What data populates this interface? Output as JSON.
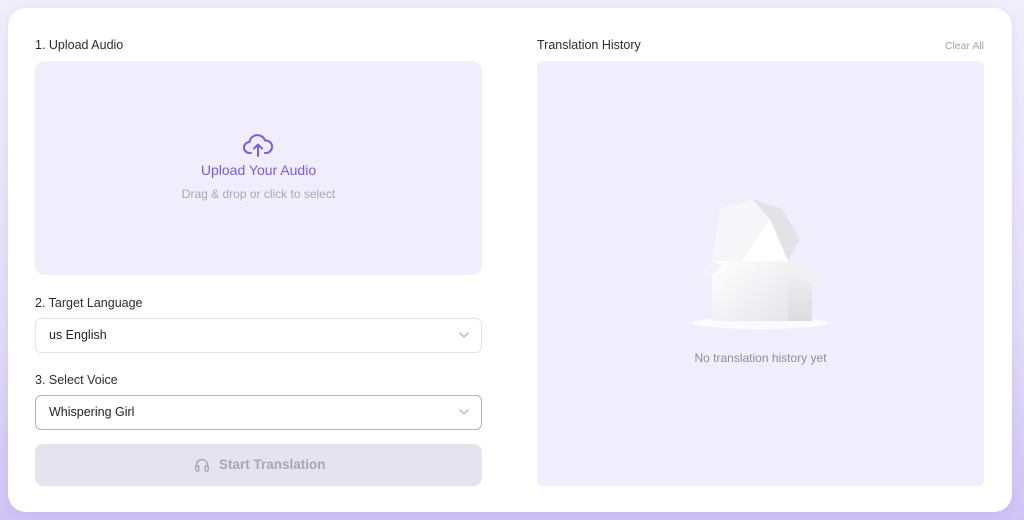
{
  "upload": {
    "section_label": "1. Upload Audio",
    "title": "Upload Your Audio",
    "subtitle": "Drag & drop or click to select",
    "icon": "cloud-upload-icon"
  },
  "language": {
    "section_label": "2. Target Language",
    "selected": "us English"
  },
  "voice": {
    "section_label": "3. Select Voice",
    "selected": "Whispering Girl"
  },
  "start_button": {
    "label": "Start Translation",
    "icon": "headphones-icon",
    "disabled": true
  },
  "history": {
    "title": "Translation History",
    "clear_label": "Clear All",
    "empty_text": "No translation history yet",
    "illustration": "empty-box-icon"
  },
  "colors": {
    "accent": "#7b5ee0",
    "panel_bg": "#f0edfd",
    "disabled_bg": "#e4e3ee"
  }
}
